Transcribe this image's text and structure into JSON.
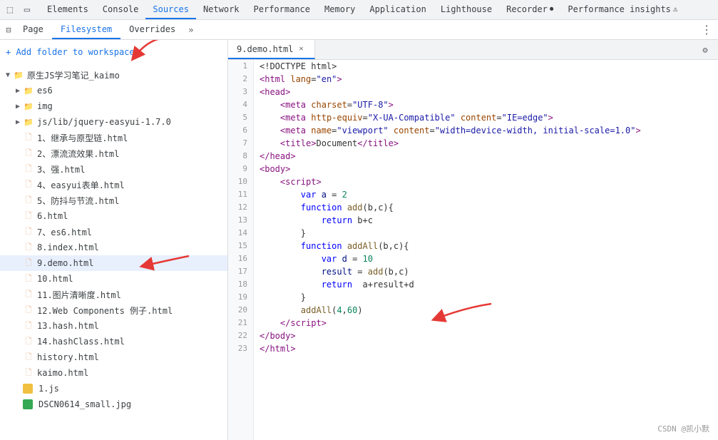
{
  "topbar": {
    "nav_items": [
      {
        "label": "Elements",
        "active": false
      },
      {
        "label": "Console",
        "active": false
      },
      {
        "label": "Sources",
        "active": true
      },
      {
        "label": "Network",
        "active": false
      },
      {
        "label": "Performance",
        "active": false
      },
      {
        "label": "Memory",
        "active": false
      },
      {
        "label": "Application",
        "active": false
      },
      {
        "label": "Lighthouse",
        "active": false
      },
      {
        "label": "Recorder",
        "active": false,
        "has_icon": true
      },
      {
        "label": "Performance insights",
        "active": false,
        "has_icon": true
      }
    ]
  },
  "second_bar": {
    "tabs": [
      {
        "label": "Page",
        "active": false
      },
      {
        "label": "Filesystem",
        "active": true
      },
      {
        "label": "Overrides",
        "active": false
      }
    ],
    "more_label": "»"
  },
  "left_panel": {
    "add_folder_label": "+ Add folder to workspace",
    "root_folder": "原生JS学习笔记_kaimo",
    "items": [
      {
        "type": "folder",
        "name": "es6",
        "indent": 1,
        "expanded": false
      },
      {
        "type": "folder",
        "name": "img",
        "indent": 1,
        "expanded": false
      },
      {
        "type": "folder",
        "name": "js/lib/jquery-easyui-1.7.0",
        "indent": 1,
        "expanded": false
      },
      {
        "type": "file",
        "name": "1、继承与原型链.html",
        "indent": 1
      },
      {
        "type": "file",
        "name": "2、漂流流效果.html",
        "indent": 1
      },
      {
        "type": "file",
        "name": "3、强.html",
        "indent": 1
      },
      {
        "type": "file",
        "name": "4、easyui表单.html",
        "indent": 1
      },
      {
        "type": "file",
        "name": "5、防抖与节流.html",
        "indent": 1
      },
      {
        "type": "file",
        "name": "6.html",
        "indent": 1
      },
      {
        "type": "file",
        "name": "7、es6.html",
        "indent": 1
      },
      {
        "type": "file",
        "name": "8.index.html",
        "indent": 1
      },
      {
        "type": "file",
        "name": "9.demo.html",
        "indent": 1,
        "selected": true
      },
      {
        "type": "file",
        "name": "10.html",
        "indent": 1
      },
      {
        "type": "file",
        "name": "11.图片清晰度.html",
        "indent": 1
      },
      {
        "type": "file",
        "name": "12.Web Components 例子.html",
        "indent": 1
      },
      {
        "type": "file",
        "name": "13.hash.html",
        "indent": 1
      },
      {
        "type": "file",
        "name": "14.hashClass.html",
        "indent": 1
      },
      {
        "type": "file",
        "name": "history.html",
        "indent": 1
      },
      {
        "type": "file",
        "name": "kaimo.html",
        "indent": 1
      },
      {
        "type": "file",
        "name": "1.js",
        "indent": 1,
        "filetype": "js"
      },
      {
        "type": "file",
        "name": "DSCN0614_small.jpg",
        "indent": 1,
        "filetype": "img"
      }
    ]
  },
  "editor": {
    "tab_label": "9.demo.html",
    "lines": [
      {
        "n": 1,
        "code": "<!DOCTYPE html>",
        "type": "tag"
      },
      {
        "n": 2,
        "code": "<html lang=\"en\">",
        "type": "tag"
      },
      {
        "n": 3,
        "code": "<head>",
        "type": "tag"
      },
      {
        "n": 4,
        "code": "    <meta charset=\"UTF-8\">",
        "type": "tag"
      },
      {
        "n": 5,
        "code": "    <meta http-equiv=\"X-UA-Compatible\" content=\"IE=edge\">",
        "type": "tag"
      },
      {
        "n": 6,
        "code": "    <meta name=\"viewport\" content=\"width=device-width, initial-scale=1.0\">",
        "type": "tag"
      },
      {
        "n": 7,
        "code": "    <title>Document</title>",
        "type": "tag"
      },
      {
        "n": 8,
        "code": "</head>",
        "type": "tag"
      },
      {
        "n": 9,
        "code": "<body>",
        "type": "tag"
      },
      {
        "n": 10,
        "code": "    <script>",
        "type": "tag"
      },
      {
        "n": 11,
        "code": "        var a = 2",
        "type": "js"
      },
      {
        "n": 12,
        "code": "        function add(b,c){",
        "type": "js"
      },
      {
        "n": 13,
        "code": "            return b+c",
        "type": "js"
      },
      {
        "n": 14,
        "code": "        }",
        "type": "js"
      },
      {
        "n": 15,
        "code": "        function addAll(b,c){",
        "type": "js"
      },
      {
        "n": 16,
        "code": "            var d = 10",
        "type": "js"
      },
      {
        "n": 17,
        "code": "            result = add(b,c)",
        "type": "js"
      },
      {
        "n": 18,
        "code": "            return  a+result+d",
        "type": "js"
      },
      {
        "n": 19,
        "code": "        }",
        "type": "js"
      },
      {
        "n": 20,
        "code": "        addAll(4,60)",
        "type": "js"
      },
      {
        "n": 21,
        "code": "    <\\/script>",
        "type": "tag"
      },
      {
        "n": 22,
        "code": "<\\/body>",
        "type": "tag"
      },
      {
        "n": 23,
        "code": "<\\/html>",
        "type": "tag"
      }
    ]
  },
  "watermark": "CSDN @凯小默"
}
